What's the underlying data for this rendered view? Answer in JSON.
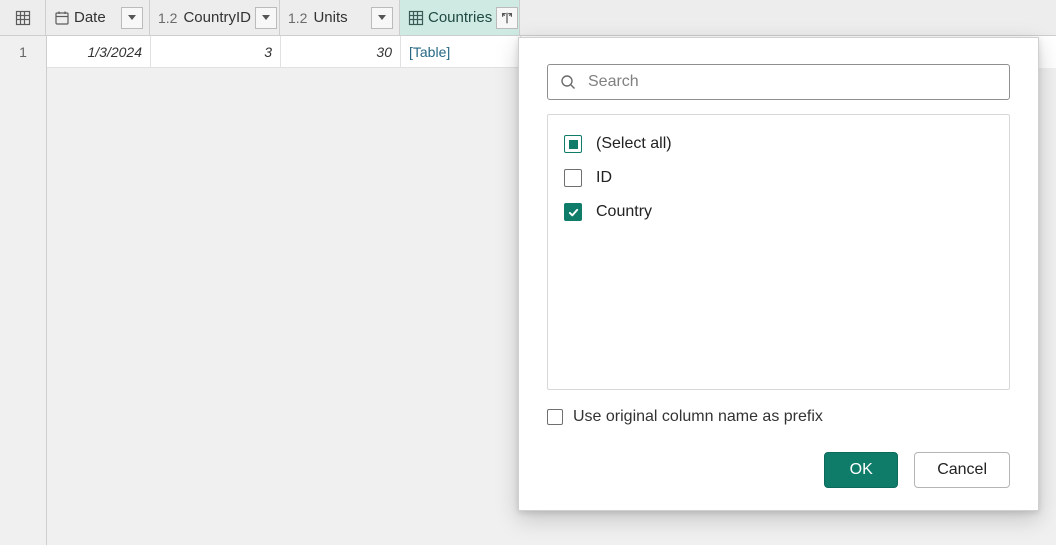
{
  "grid": {
    "columns": [
      {
        "id": "rownum",
        "type": "rownum"
      },
      {
        "id": "date",
        "label": "Date",
        "dtype": "date"
      },
      {
        "id": "cid",
        "label": "CountryID",
        "dtype": "number"
      },
      {
        "id": "units",
        "label": "Units",
        "dtype": "number"
      },
      {
        "id": "ctry",
        "label": "Countries",
        "dtype": "table",
        "highlighted": true
      }
    ],
    "number_type_glyph": "1.2",
    "rows": [
      {
        "n": "1",
        "date": "1/3/2024",
        "cid": "3",
        "units": "30",
        "ctry": "[Table]"
      }
    ]
  },
  "popup": {
    "search_placeholder": "Search",
    "options": [
      {
        "label": "(Select all)",
        "state": "indeterminate"
      },
      {
        "label": "ID",
        "state": "unchecked"
      },
      {
        "label": "Country",
        "state": "checked"
      }
    ],
    "prefix_label": "Use original column name as prefix",
    "prefix_checked": false,
    "buttons": {
      "ok": "OK",
      "cancel": "Cancel"
    }
  }
}
